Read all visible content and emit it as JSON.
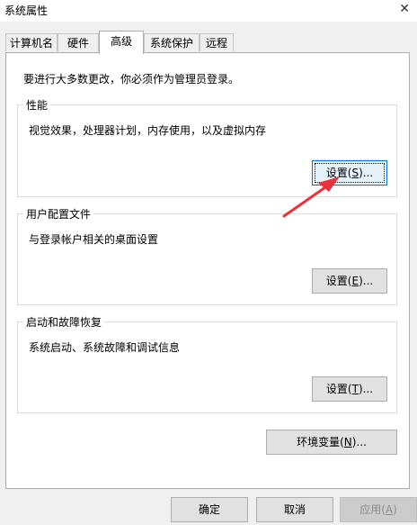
{
  "window": {
    "title": "系统属性",
    "close_glyph": "✕"
  },
  "tabs": [
    {
      "label": "计算机名"
    },
    {
      "label": "硬件"
    },
    {
      "label": "高级"
    },
    {
      "label": "系统保护"
    },
    {
      "label": "远程"
    }
  ],
  "notice": "要进行大多数更改，你必须作为管理员登录。",
  "performance": {
    "legend": "性能",
    "desc": "视觉效果，处理器计划，内存使用，以及虚拟内存",
    "btn_pre": "设置(",
    "btn_key": "S",
    "btn_post": ")..."
  },
  "profiles": {
    "legend": "用户配置文件",
    "desc": "与登录帐户相关的桌面设置",
    "btn_pre": "设置(",
    "btn_key": "E",
    "btn_post": ")..."
  },
  "startup": {
    "legend": "启动和故障恢复",
    "desc": "系统启动、系统故障和调试信息",
    "btn_pre": "设置(",
    "btn_key": "T",
    "btn_post": ")..."
  },
  "env": {
    "btn_pre": "环境变量(",
    "btn_key": "N",
    "btn_post": ")..."
  },
  "footer": {
    "ok": "确定",
    "cancel": "取消",
    "apply_pre": "应用(",
    "apply_key": "A",
    "apply_post": ")"
  },
  "colors": {
    "annotation_arrow": "#e8323c",
    "focus_border": "#0078d7"
  }
}
